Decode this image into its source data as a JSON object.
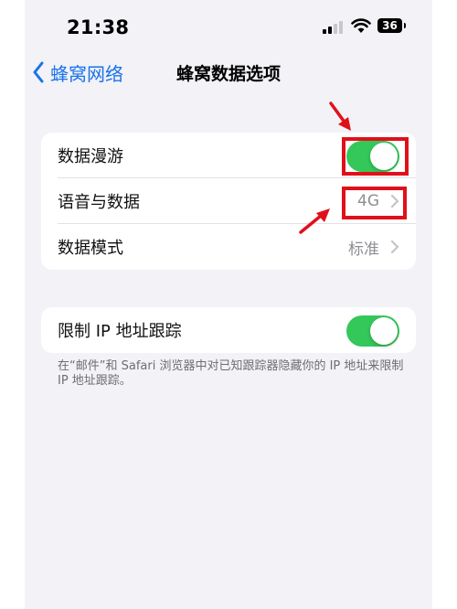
{
  "status_bar": {
    "time": "21:38",
    "battery_level": "36"
  },
  "nav": {
    "back_label": "蜂窝网络",
    "title": "蜂窝数据选项"
  },
  "settings_group": {
    "rows": [
      {
        "label": "数据漫游",
        "control": "toggle",
        "state": "on"
      },
      {
        "label": "语音与数据",
        "value": "4G"
      },
      {
        "label": "数据模式",
        "value": "标准"
      }
    ]
  },
  "privacy_group": {
    "label": "限制 IP 地址跟踪",
    "control": "toggle",
    "state": "on",
    "footnote": "在“邮件”和 Safari 浏览器中对已知跟踪器隐藏你的 IP 地址来限制 IP 地址跟踪。"
  },
  "colors": {
    "accent": "#1a73e8",
    "toggle_on": "#34c759",
    "annotation": "#e0101a",
    "background": "#f2f2f7"
  }
}
